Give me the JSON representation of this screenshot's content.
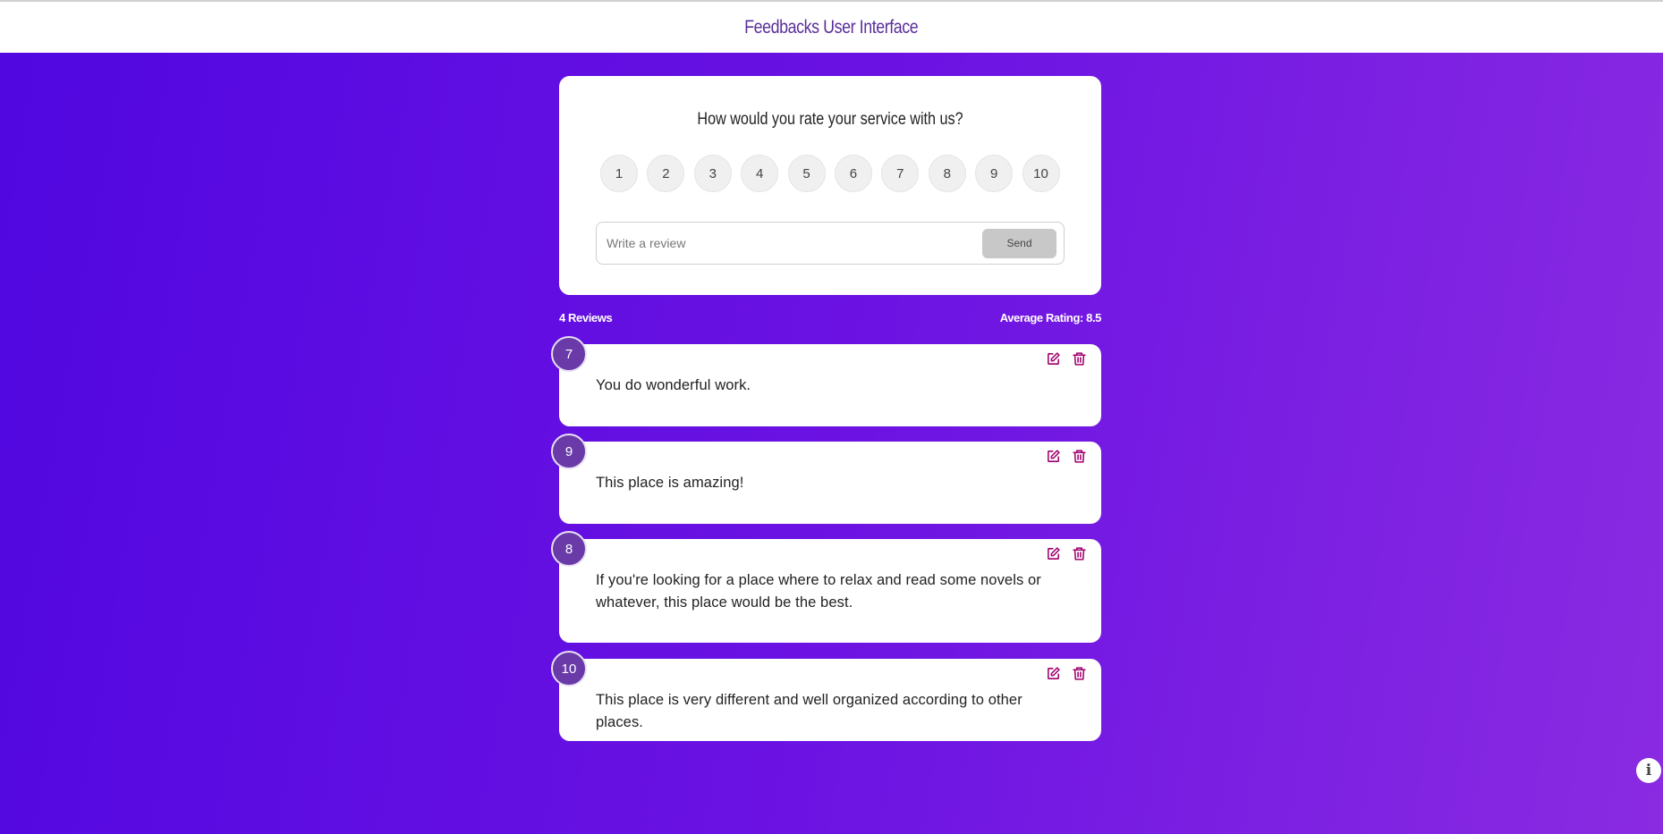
{
  "app": {
    "title": "Feedbacks User Interface"
  },
  "rating_form": {
    "question": "How would you rate your service with us?",
    "options": [
      "1",
      "2",
      "3",
      "4",
      "5",
      "6",
      "7",
      "8",
      "9",
      "10"
    ],
    "input_placeholder": "Write a review",
    "input_value": "",
    "send_label": "Send"
  },
  "stats": {
    "review_count": "4 Reviews",
    "average": "Average Rating: 8.5"
  },
  "reviews": [
    {
      "rating": "7",
      "text": "You do wonderful work."
    },
    {
      "rating": "9",
      "text": "This place is amazing!"
    },
    {
      "rating": "8",
      "text": "If you're looking for a place where to relax and read some novels or whatever, this place would be the best."
    },
    {
      "rating": "10",
      "text": "This place is very different and well organized according to other places."
    }
  ],
  "icons": {
    "edit": "edit-icon",
    "delete": "trash-icon",
    "info": "info-icon"
  },
  "colors": {
    "accent": "#6a3aa8",
    "icon": "#a0006e",
    "gradient_start": "#5007e0",
    "gradient_end": "#8a2be2"
  },
  "info_glyph": "i"
}
